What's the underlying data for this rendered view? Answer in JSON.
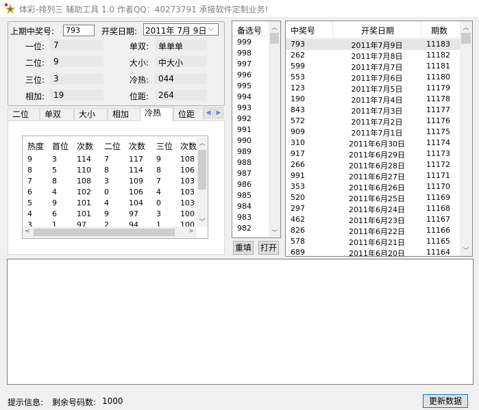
{
  "window": {
    "title": "体彩-排列三 辅助工具 1.0  作者QQ：40273791  承接软件定制业务!"
  },
  "last_draw": {
    "number_label": "上期中奖号:",
    "number_value": "793",
    "date_label": "开奖日期:",
    "date_value": "2011年 7月 9日"
  },
  "stats": [
    {
      "label": "一位:",
      "value": "7"
    },
    {
      "label": "二位:",
      "value": "9"
    },
    {
      "label": "三位:",
      "value": "3"
    },
    {
      "label": "相加:",
      "value": "19"
    },
    {
      "label": "单双:",
      "value": "单单单"
    },
    {
      "label": "大小:",
      "value": "中大小"
    },
    {
      "label": "冷热:",
      "value": "044"
    },
    {
      "label": "位距:",
      "value": "264"
    }
  ],
  "tabs": [
    "二位",
    "单双",
    "大小",
    "相加",
    "冷热",
    "位距"
  ],
  "active_tab": "冷热",
  "heat_table": {
    "headers": [
      "热度",
      "首位",
      "次数",
      "二位",
      "次数",
      "三位",
      "次数"
    ],
    "rows": [
      [
        "9",
        "3",
        "114",
        "7",
        "117",
        "9",
        "108"
      ],
      [
        "8",
        "5",
        "110",
        "8",
        "114",
        "8",
        "106"
      ],
      [
        "7",
        "8",
        "108",
        "3",
        "109",
        "7",
        "103"
      ],
      [
        "6",
        "4",
        "102",
        "0",
        "106",
        "4",
        "103"
      ],
      [
        "5",
        "9",
        "101",
        "4",
        "104",
        "0",
        "103"
      ],
      [
        "4",
        "6",
        "101",
        "9",
        "97",
        "3",
        "100"
      ],
      [
        "3",
        "1",
        "97",
        "2",
        "94",
        "1",
        "100"
      ]
    ]
  },
  "backup": {
    "header": "备选号",
    "items": [
      "999",
      "998",
      "997",
      "996",
      "995",
      "994",
      "993",
      "992",
      "991",
      "990",
      "989",
      "988",
      "987",
      "986",
      "985",
      "984",
      "983",
      "982"
    ]
  },
  "buttons": {
    "refill": "重填",
    "open": "打开",
    "update": "更新数据"
  },
  "results": {
    "headers": [
      "中奖号",
      "开奖日期",
      "期数"
    ],
    "rows": [
      [
        "793",
        "2011年7月9日",
        "11183"
      ],
      [
        "262",
        "2011年7月8日",
        "11182"
      ],
      [
        "599",
        "2011年7月7日",
        "11181"
      ],
      [
        "553",
        "2011年7月6日",
        "11180"
      ],
      [
        "123",
        "2011年7月5日",
        "11179"
      ],
      [
        "190",
        "2011年7月4日",
        "11178"
      ],
      [
        "843",
        "2011年7月3日",
        "11177"
      ],
      [
        "572",
        "2011年7月2日",
        "11176"
      ],
      [
        "909",
        "2011年7月1日",
        "11175"
      ],
      [
        "310",
        "2011年6月30日",
        "11174"
      ],
      [
        "917",
        "2011年6月29日",
        "11173"
      ],
      [
        "266",
        "2011年6月28日",
        "11172"
      ],
      [
        "991",
        "2011年6月27日",
        "11171"
      ],
      [
        "353",
        "2011年6月26日",
        "11170"
      ],
      [
        "520",
        "2011年6月25日",
        "11169"
      ],
      [
        "297",
        "2011年6月24日",
        "11168"
      ],
      [
        "462",
        "2011年6月23日",
        "11167"
      ],
      [
        "826",
        "2011年6月22日",
        "11166"
      ],
      [
        "578",
        "2011年6月21日",
        "11165"
      ],
      [
        "689",
        "2011年6月20日",
        "11164"
      ]
    ]
  },
  "status": {
    "label": "提示信息:",
    "remaining_label": "剩余号码数:",
    "remaining_value": "1000"
  },
  "colors": {
    "selection": "#e5e5e5",
    "tab_arrow": "#5b8bd6"
  }
}
